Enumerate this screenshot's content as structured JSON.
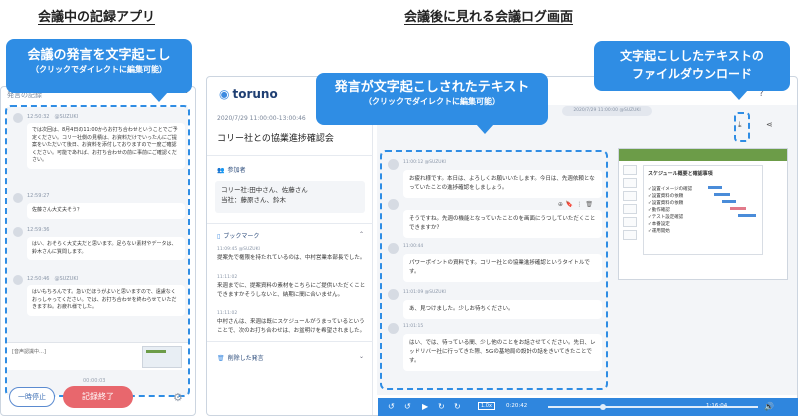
{
  "headings": {
    "left": "会議中の記録アプリ",
    "right": "会議後に見れる会議ログ画面"
  },
  "callouts": {
    "left": {
      "title": "会議の発言を文字起こし",
      "sub": "（クリックでダイレクトに編集可能）"
    },
    "middle": {
      "title": "発言が文字起こしされたテキスト",
      "sub": "（クリックでダイレクトに編集可能）"
    },
    "right": {
      "title": "文字起こししたテキストの",
      "title2": "ファイルダウンロード"
    }
  },
  "phone": {
    "topbar": "発言の記録",
    "messages": [
      {
        "time": "12:50:32",
        "speaker": "@SUZUKI",
        "text": "では次回は、8月4日の11:00からお打ち合わせということでご予定ください。コリー社側の見積は、お資料だけでいったんにご提案をいただいて後日、お資料を添付しておりますので一度ご確認ください。可能であれば、お打ち合わせの前に事前にご確認ください。"
      },
      {
        "time": "12:59:27",
        "speaker": "",
        "text": "佐藤さん大丈夫そう？"
      },
      {
        "time": "12:59:36",
        "speaker": "",
        "text": "はい、おそらく大丈夫だと思います。足らない素材やデータは、鈴木さんに質問します。"
      },
      {
        "time": "12:50:46",
        "speaker": "@SUZUKI",
        "text": "はいもちろんです。急いだほうがよいと思いますので、遠慮なくおっしゃってください。では、お打ち合わせを終わらせていただきますね。お疲れ様でした。"
      }
    ],
    "input_placeholder": "[音声認識中…]",
    "timer": "00:00:03",
    "pause_label": "一時停止",
    "end_label": "記録終了"
  },
  "app": {
    "logo": "toruno",
    "meeting_date": "2020/7/29 11:00:00-13:00:46",
    "meeting_title": "コリー社との協業進捗確認会",
    "participants_label": "参加者",
    "participants": [
      "コリー社:田中さん、佐藤さん",
      "当社：藤原さん、鈴木"
    ],
    "bookmark_label": "ブックマーク",
    "bookmarks": [
      {
        "time": "11:09:45 @SUZUKI",
        "text": "提案先で権限を持たれているのは、中村営業本部長でした。"
      },
      {
        "time": "11:11:02",
        "text": "来週までに、提案資料の素材をこちらにご提供いただくことできますかそうしないと、納期に間に合いません。"
      },
      {
        "time": "11:11:02",
        "text": "中村さんは、来週は既にスケジュールがうまっているということで、次のお打ち合わせは、お盆明けを希望されました。"
      }
    ],
    "deleted_label": "削除した発言",
    "date_pill": "2020/7/29 11:00:00 @SUZUKI",
    "messages": [
      {
        "time": "11:00:12 @SUZUKI",
        "text": "お疲れ様です。本日は、よろしくお願いいたします。今日は、先週依頼となっていたことの進捗確認をしましょう。"
      },
      {
        "time": "",
        "text": "そうですね。先週の機能となっていたことのを画面にうつしていただくことできますか？"
      },
      {
        "time": "11:00:44",
        "text": "パワーポイントの資料です。コリー社との協業進捗確認というタイトルです。"
      },
      {
        "time": "11:01:09 @SUZUKI",
        "text": "あ、見つけました。少しお待ちください。"
      },
      {
        "time": "11:01:15",
        "text": "はい、では、待っている間、少し他のことをお話させてください。先日、レッドリバー社に行ってきた際、5Gの基地局の設計の話をきいてきたことです。"
      }
    ],
    "slide": {
      "title": "スケジュール概要と確認事項",
      "items": [
        "✓設置イメージの確認",
        "✓設置資料の依頼",
        "✓設置資料の依頼",
        "✓動作確認",
        "✓テスト設定確認",
        "✓本番設定",
        "✓運用開始"
      ]
    },
    "player": {
      "speed": "1.0x",
      "current": "0:20:42",
      "total": "1:16:04"
    }
  },
  "colors": {
    "accent": "#2f8de4",
    "end_button": "#e8676d",
    "player": "#2f86de"
  }
}
